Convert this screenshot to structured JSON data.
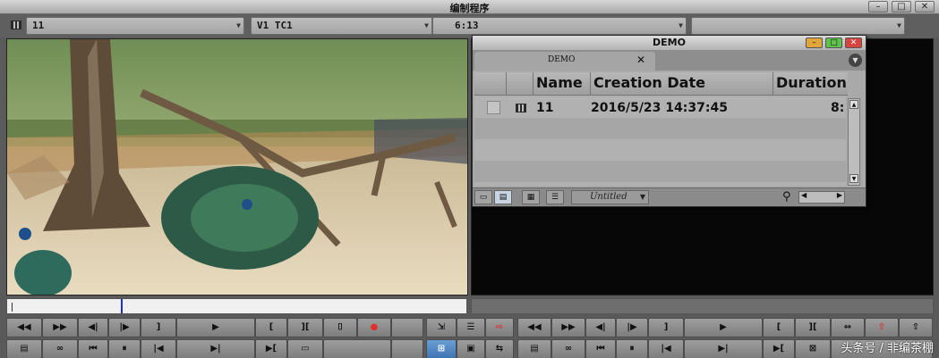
{
  "app": {
    "title": "编制程序"
  },
  "infobar": {
    "source_clip": "11",
    "track_info": "V1 TC1",
    "timecode": "6:13",
    "record_field": ""
  },
  "bin": {
    "title": "DEMO",
    "tab_label": "DEMO",
    "columns": [
      "Name",
      "Creation Date",
      "Duration"
    ],
    "rows": [
      {
        "name": "11",
        "creation_date": "2016/5/23 14:37:45",
        "duration": "8:"
      }
    ],
    "view_name": "Untitled"
  },
  "colors": {
    "accent_red": "#e13030",
    "record_bg": "#070707",
    "panel": "#5a5a5a"
  },
  "watermark": "头条号 / 非编茶棚"
}
